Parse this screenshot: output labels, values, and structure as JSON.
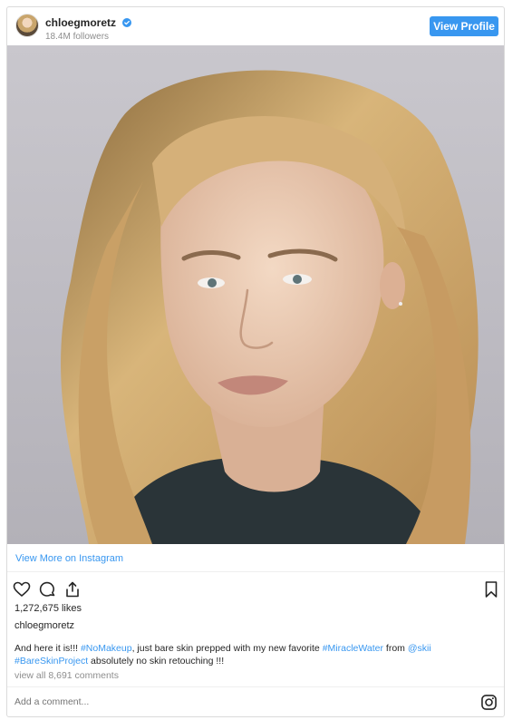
{
  "header": {
    "username": "chloegmoretz",
    "followers": "18.4M followers",
    "view_profile_label": "View Profile",
    "avatar_icon": "avatar-icon",
    "verified_icon": "verified-badge-icon"
  },
  "post": {
    "view_more_label": "View More on Instagram",
    "likes": "1,272,675 likes",
    "owner": "chloegmoretz",
    "caption": {
      "t1": "And here it is!!! ",
      "tag1": "#NoMakeup",
      "t2": ", just bare skin prepped with my new favorite ",
      "tag2": "#MiracleWater",
      "t3": " from ",
      "mention": "@skii",
      "tag3": "#BareSkinProject",
      "t4": " absolutely no skin retouching !!!"
    },
    "view_comments_label": "view all 8,691 comments",
    "comment_placeholder": "Add a comment...",
    "actions": [
      "heart-icon",
      "comment-icon",
      "share-icon",
      "bookmark-icon"
    ],
    "footer_icon": "instagram-icon"
  },
  "colors": {
    "accent": "#3897f0",
    "text": "#262626",
    "muted": "#8e8e8e",
    "border": "#dbdbdb"
  }
}
